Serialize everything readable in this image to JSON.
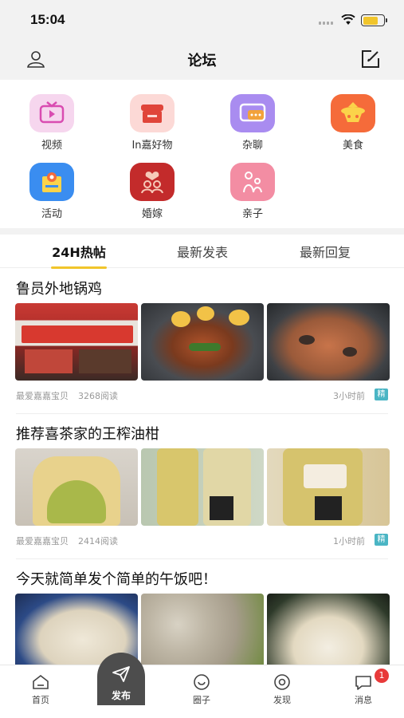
{
  "status": {
    "time": "15:04"
  },
  "header": {
    "title": "论坛"
  },
  "categories": [
    {
      "label": "视频",
      "icon": "tv-icon",
      "color": "#f6d6ee"
    },
    {
      "label": "In嘉好物",
      "icon": "shop-icon",
      "color": "#fcd9d6"
    },
    {
      "label": "杂聊",
      "icon": "chat-icon",
      "color": "#a98cf0"
    },
    {
      "label": "美食",
      "icon": "food-icon",
      "color": "#f56b3a"
    },
    {
      "label": "活动",
      "icon": "activity-icon",
      "color": "#3a8df0"
    },
    {
      "label": "婚嫁",
      "icon": "wedding-icon",
      "color": "#c32b2b"
    },
    {
      "label": "亲子",
      "icon": "family-icon",
      "color": "#f38da3"
    }
  ],
  "tabs": [
    {
      "label": "24H热帖",
      "active": true
    },
    {
      "label": "最新发表",
      "active": false
    },
    {
      "label": "最新回复",
      "active": false
    }
  ],
  "posts": [
    {
      "title": "鲁员外地锅鸡",
      "author": "最爱嘉嘉宝贝",
      "reads": "3268阅读",
      "time": "3小时前",
      "badge": "精"
    },
    {
      "title": "推荐喜茶家的王榨油柑",
      "author": "最爱嘉嘉宝贝",
      "reads": "2414阅读",
      "time": "1小时前",
      "badge": "精"
    },
    {
      "title": "今天就简单发个简单的午饭吧！"
    }
  ],
  "tabbar": {
    "home": "首页",
    "publish": "发布",
    "circle": "圈子",
    "discover": "发现",
    "messages": "消息",
    "message_count": "1"
  },
  "colors": {
    "accent": "#f1c52b",
    "badge": "#4ab5c4",
    "dark": "#4d4d4d",
    "red": "#e83a3a"
  }
}
